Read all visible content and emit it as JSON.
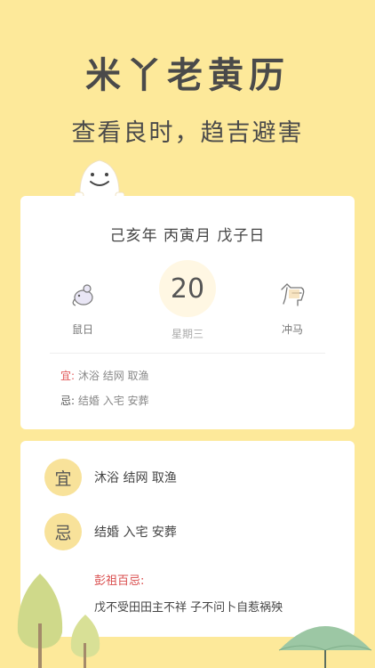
{
  "header": {
    "title": "米丫老黄历",
    "subtitle": "查看良时，趋吉避害"
  },
  "summary_card": {
    "ganzhi": "己亥年 丙寅月 戊子日",
    "day_zodiac_label": "鼠日",
    "date_number": "20",
    "weekday": "星期三",
    "clash_label": "冲马",
    "yi_tag": "宜:",
    "yi_items": "沐浴 结网 取渔",
    "ji_tag": "忌:",
    "ji_items": "结婚 入宅 安葬"
  },
  "detail_card": {
    "yi_badge": "宜",
    "yi_items": "沐浴 结网 取渔",
    "ji_badge": "忌",
    "ji_items": "结婚 入宅 安葬",
    "pengzu_title": "彭祖百忌:",
    "pengzu_text": "戊不受田田主不祥 子不问卜自惹祸殃"
  },
  "colors": {
    "background": "#fde99a",
    "badge": "#f8e29a",
    "accent_red": "#e25a5a"
  },
  "icons": [
    "ghost-mascot-icon",
    "rat-icon",
    "horse-icon",
    "tree-icon",
    "umbrella-icon"
  ]
}
